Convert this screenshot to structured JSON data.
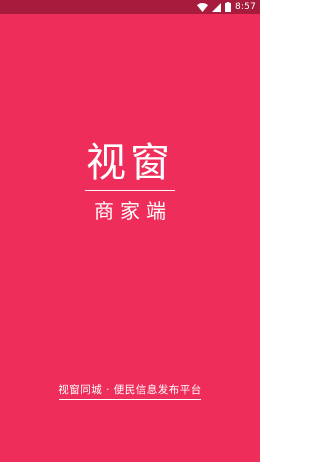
{
  "status_bar": {
    "time": "8:57",
    "icons": [
      "wifi-icon",
      "signal-icon",
      "battery-icon"
    ]
  },
  "splash": {
    "logo_text": "视窗",
    "subtitle": "商家端",
    "tagline": "视窗同城 · 便民信息发布平台"
  },
  "colors": {
    "background": "#ee2d5a",
    "status_bar": "#a71b3d",
    "foreground": "#ffffff"
  }
}
